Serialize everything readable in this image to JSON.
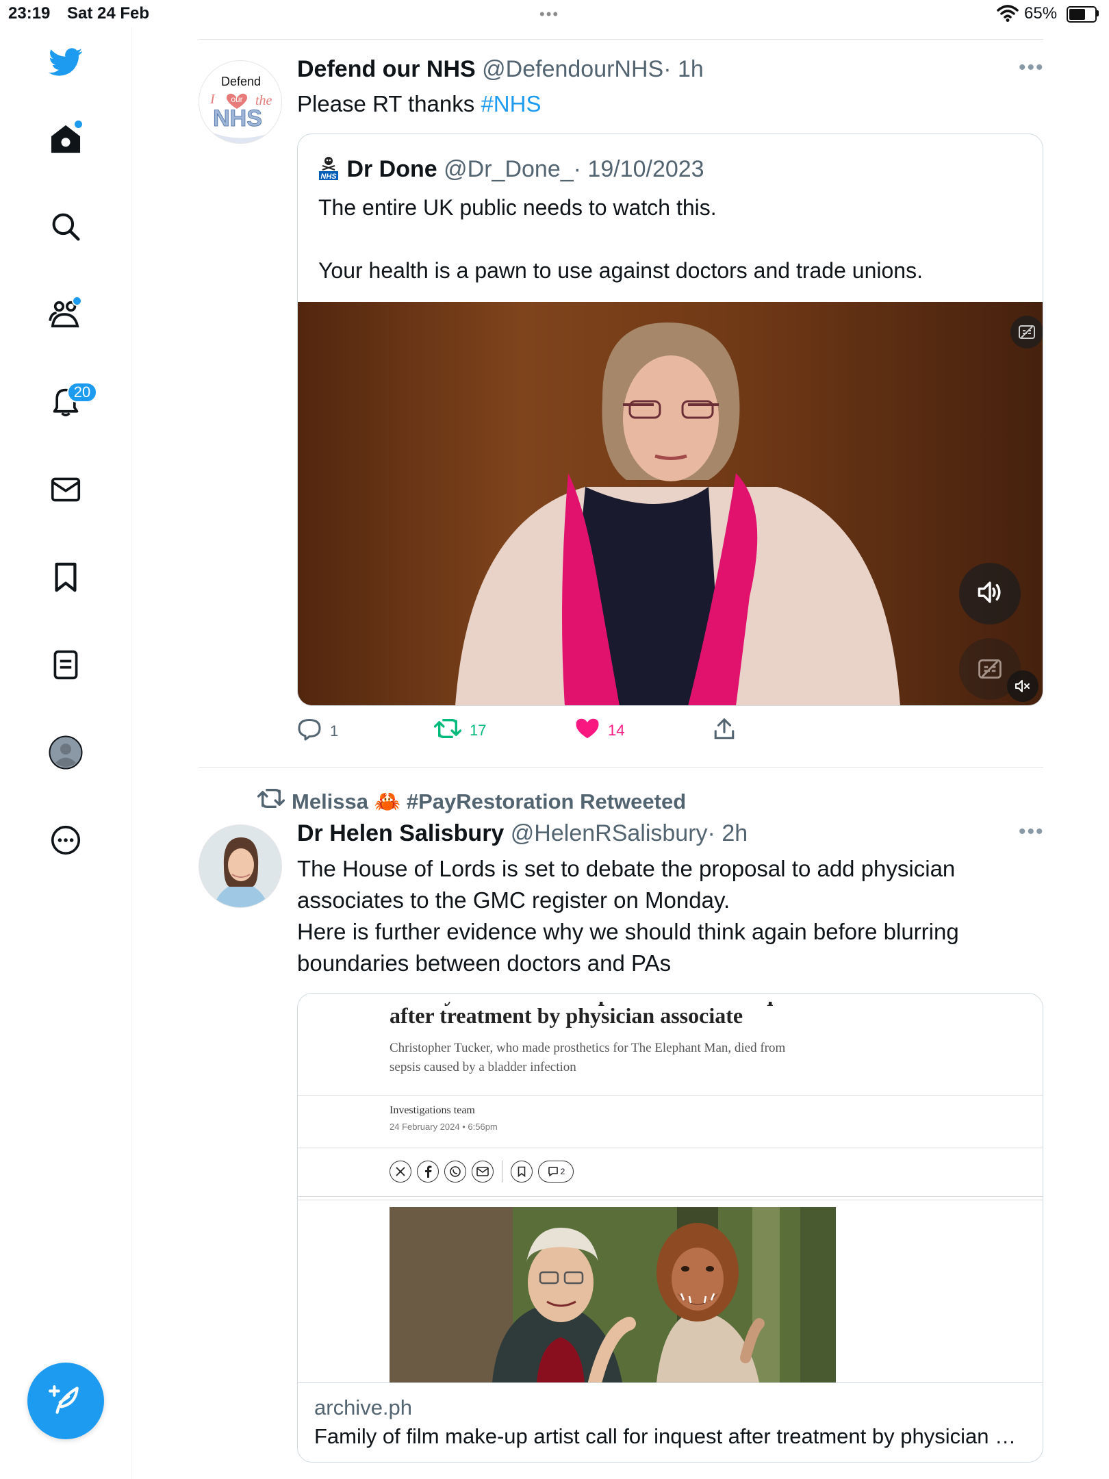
{
  "status_bar": {
    "time": "23:19",
    "date": "Sat 24 Feb",
    "battery": "65%",
    "battery_level": 0.65,
    "multitask_dots": "•••"
  },
  "sidebar": {
    "notifications_badge": "20",
    "icons": [
      "twitter-bird-icon",
      "home-icon",
      "search-icon",
      "communities-icon",
      "notifications-icon",
      "messages-icon",
      "bookmarks-icon",
      "lists-icon",
      "profile-avatar",
      "more-icon",
      "compose-icon"
    ],
    "accent": "#1d9bf0"
  },
  "tweets": [
    {
      "name": "Defend our NHS",
      "handle": "@DefendourNHS",
      "time": "· 1h",
      "text": "Please RT thanks ",
      "hashtag": "#NHS",
      "avatar": {
        "line1": "Defend",
        "line2": "I",
        "line3": "our",
        "line4": "the",
        "line5": "NHS"
      },
      "quote": {
        "name": "Dr Done",
        "handle": "@Dr_Done_",
        "time": "· 19/10/2023",
        "badge": "NHS",
        "text_line1": "The entire UK public needs to watch this.",
        "text_line2": "Your health is a pawn to use against doctors and trade unions."
      },
      "actions": {
        "replies": "1",
        "retweets": "17",
        "likes": "14"
      }
    },
    {
      "retweeted_by": "Melissa 🦀 #PayRestoration Retweeted",
      "name": "Dr Helen Salisbury",
      "handle": "@HelenRSalisbury",
      "time": "· 2h",
      "text_lines": [
        "The House of Lords is set to debate the proposal to add physician",
        "associates to the GMC register on Monday.",
        "Here is further evidence why we should think again before blurring",
        "boundaries between doctors and PAs"
      ],
      "link_card": {
        "cut_title": "Family of film make-up artist call for inquest",
        "title": "after treatment by physician associate",
        "subtitle": "Christopher Tucker, who made prosthetics for The Elephant Man, died from sepsis caused by a bladder infection",
        "author": "Investigations team",
        "date": "24 February 2024 • 6:56pm",
        "comment_count": "2",
        "domain": "archive.ph",
        "link_title": "Family of film make-up artist call for inquest after treatment by physician associate"
      }
    }
  ]
}
